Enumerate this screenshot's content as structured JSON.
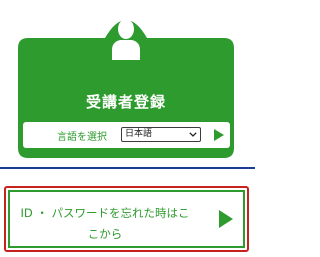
{
  "registration": {
    "title": "受講者登録",
    "language_label": "言語を選択",
    "language_selected": "日本語"
  },
  "forgot": {
    "label": "ID ・ パスワードを忘れた時はここから"
  },
  "colors": {
    "brand_green": "#2e9b2e",
    "rule_blue": "#1d3c94",
    "focus_red": "#c8221f"
  },
  "icons": [
    "user-avatar-icon",
    "chevron-down-icon",
    "arrow-right-icon"
  ]
}
